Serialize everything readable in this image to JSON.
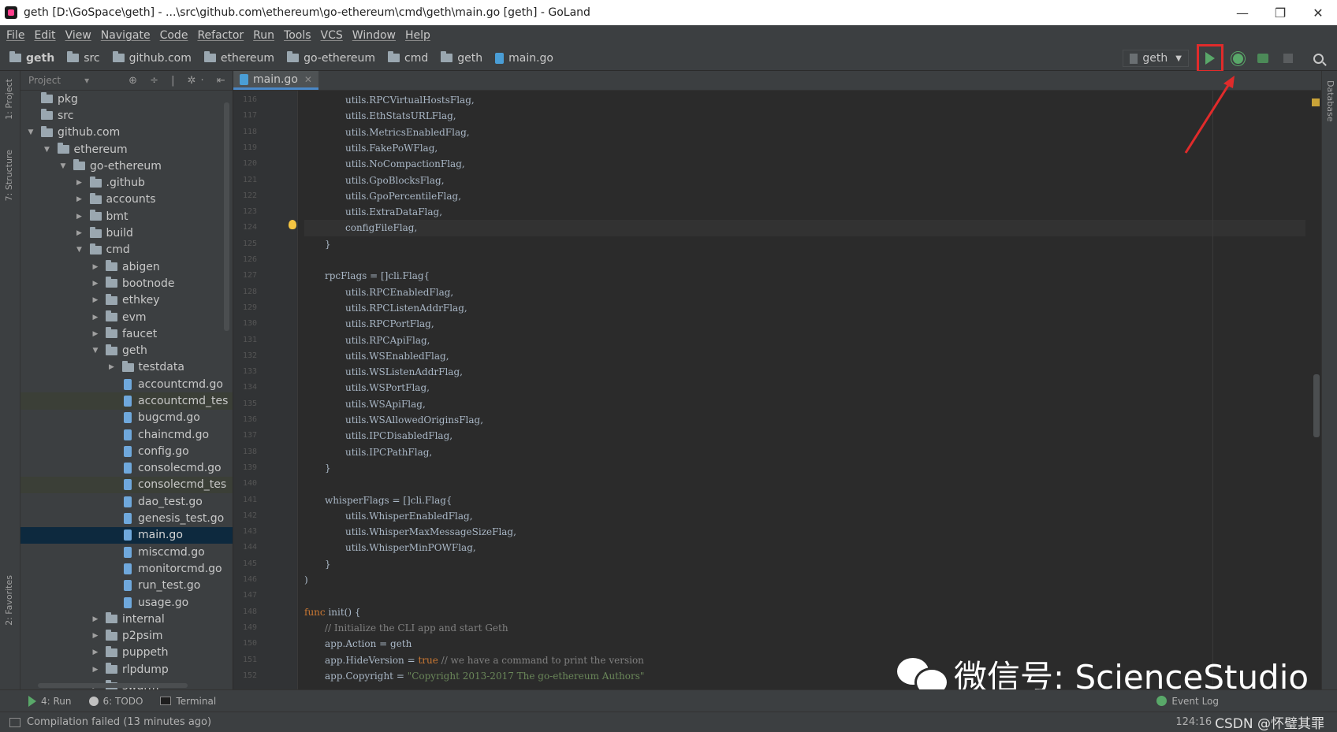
{
  "window": {
    "title": "geth [D:\\GoSpace\\geth] - ...\\src\\github.com\\ethereum\\go-ethereum\\cmd\\geth\\main.go [geth] - GoLand",
    "minimize": "—",
    "restore": "❐",
    "close": "✕"
  },
  "menu": [
    "File",
    "Edit",
    "View",
    "Navigate",
    "Code",
    "Refactor",
    "Run",
    "Tools",
    "VCS",
    "Window",
    "Help"
  ],
  "breadcrumbs": [
    "geth",
    "src",
    "github.com",
    "ethereum",
    "go-ethereum",
    "cmd",
    "geth",
    "main.go"
  ],
  "run_config": {
    "name": "geth",
    "dropdown": "▼"
  },
  "project_panel": {
    "title": "Project",
    "dropdown": "▾",
    "tools": "⊕ ÷ | ✲· ⇤"
  },
  "tree": [
    {
      "label": "pkg",
      "depth": 0,
      "type": "folder",
      "arrow": ""
    },
    {
      "label": "src",
      "depth": 0,
      "type": "folder",
      "arrow": ""
    },
    {
      "label": "github.com",
      "depth": 0,
      "type": "folder",
      "arrow": "▼"
    },
    {
      "label": "ethereum",
      "depth": 1,
      "type": "folder",
      "arrow": "▼"
    },
    {
      "label": "go-ethereum",
      "depth": 2,
      "type": "folder",
      "arrow": "▼"
    },
    {
      "label": ".github",
      "depth": 3,
      "type": "folder",
      "arrow": "▶"
    },
    {
      "label": "accounts",
      "depth": 3,
      "type": "folder",
      "arrow": "▶"
    },
    {
      "label": "bmt",
      "depth": 3,
      "type": "folder",
      "arrow": "▶"
    },
    {
      "label": "build",
      "depth": 3,
      "type": "folder",
      "arrow": "▶"
    },
    {
      "label": "cmd",
      "depth": 3,
      "type": "folder",
      "arrow": "▼"
    },
    {
      "label": "abigen",
      "depth": 4,
      "type": "folder",
      "arrow": "▶"
    },
    {
      "label": "bootnode",
      "depth": 4,
      "type": "folder",
      "arrow": "▶"
    },
    {
      "label": "ethkey",
      "depth": 4,
      "type": "folder",
      "arrow": "▶"
    },
    {
      "label": "evm",
      "depth": 4,
      "type": "folder",
      "arrow": "▶"
    },
    {
      "label": "faucet",
      "depth": 4,
      "type": "folder",
      "arrow": "▶"
    },
    {
      "label": "geth",
      "depth": 4,
      "type": "folder",
      "arrow": "▼"
    },
    {
      "label": "testdata",
      "depth": 5,
      "type": "folder",
      "arrow": "▶"
    },
    {
      "label": "accountcmd.go",
      "depth": 6,
      "type": "file",
      "arrow": ""
    },
    {
      "label": "accountcmd_tes",
      "depth": 6,
      "type": "file",
      "arrow": "",
      "warn": true
    },
    {
      "label": "bugcmd.go",
      "depth": 6,
      "type": "file",
      "arrow": ""
    },
    {
      "label": "chaincmd.go",
      "depth": 6,
      "type": "file",
      "arrow": ""
    },
    {
      "label": "config.go",
      "depth": 6,
      "type": "file",
      "arrow": ""
    },
    {
      "label": "consolecmd.go",
      "depth": 6,
      "type": "file",
      "arrow": ""
    },
    {
      "label": "consolecmd_tes",
      "depth": 6,
      "type": "file",
      "arrow": "",
      "warn": true
    },
    {
      "label": "dao_test.go",
      "depth": 6,
      "type": "file",
      "arrow": ""
    },
    {
      "label": "genesis_test.go",
      "depth": 6,
      "type": "file",
      "arrow": ""
    },
    {
      "label": "main.go",
      "depth": 6,
      "type": "file",
      "arrow": "",
      "selected": true
    },
    {
      "label": "misccmd.go",
      "depth": 6,
      "type": "file",
      "arrow": ""
    },
    {
      "label": "monitorcmd.go",
      "depth": 6,
      "type": "file",
      "arrow": ""
    },
    {
      "label": "run_test.go",
      "depth": 6,
      "type": "file",
      "arrow": ""
    },
    {
      "label": "usage.go",
      "depth": 6,
      "type": "file",
      "arrow": ""
    },
    {
      "label": "internal",
      "depth": 4,
      "type": "folder",
      "arrow": "▶"
    },
    {
      "label": "p2psim",
      "depth": 4,
      "type": "folder",
      "arrow": "▶"
    },
    {
      "label": "puppeth",
      "depth": 4,
      "type": "folder",
      "arrow": "▶"
    },
    {
      "label": "rlpdump",
      "depth": 4,
      "type": "folder",
      "arrow": "▶"
    },
    {
      "label": "swarm",
      "depth": 4,
      "type": "folder",
      "arrow": "▶"
    }
  ],
  "left_tabs": [
    "1: Project",
    "7: Structure",
    "2: Favorites"
  ],
  "right_tabs": [
    "Database"
  ],
  "editor": {
    "tab": "main.go",
    "tab_close": "✕",
    "line_numbers": [
      "116",
      "117",
      "118",
      "119",
      "120",
      "121",
      "122",
      "123",
      "124",
      "125",
      "126",
      "127",
      "128",
      "129",
      "130",
      "131",
      "132",
      "133",
      "134",
      "135",
      "136",
      "137",
      "138",
      "139",
      "140",
      "141",
      "142",
      "143",
      "144",
      "145",
      "146",
      "147",
      "148",
      "149",
      "150",
      "151",
      "152"
    ],
    "code": [
      {
        "indent": 2,
        "parts": [
          {
            "t": "utils.RPCVirtualHostsFlag,",
            "c": ""
          }
        ]
      },
      {
        "indent": 2,
        "parts": [
          {
            "t": "utils.EthStatsURLFlag,",
            "c": ""
          }
        ]
      },
      {
        "indent": 2,
        "parts": [
          {
            "t": "utils.MetricsEnabledFlag,",
            "c": ""
          }
        ]
      },
      {
        "indent": 2,
        "parts": [
          {
            "t": "utils.FakePoWFlag,",
            "c": ""
          }
        ]
      },
      {
        "indent": 2,
        "parts": [
          {
            "t": "utils.NoCompactionFlag,",
            "c": ""
          }
        ]
      },
      {
        "indent": 2,
        "parts": [
          {
            "t": "utils.GpoBlocksFlag,",
            "c": ""
          }
        ]
      },
      {
        "indent": 2,
        "parts": [
          {
            "t": "utils.GpoPercentileFlag,",
            "c": ""
          }
        ]
      },
      {
        "indent": 2,
        "parts": [
          {
            "t": "utils.ExtraDataFlag,",
            "c": ""
          }
        ]
      },
      {
        "indent": 2,
        "parts": [
          {
            "t": "configFileFlag,",
            "c": ""
          }
        ],
        "hl": true
      },
      {
        "indent": 1,
        "parts": [
          {
            "t": "}",
            "c": ""
          }
        ]
      },
      {
        "indent": 0,
        "parts": [
          {
            "t": "",
            "c": ""
          }
        ]
      },
      {
        "indent": 1,
        "parts": [
          {
            "t": "rpcFlags = []cli.Flag{",
            "c": ""
          }
        ]
      },
      {
        "indent": 2,
        "parts": [
          {
            "t": "utils.RPCEnabledFlag,",
            "c": ""
          }
        ]
      },
      {
        "indent": 2,
        "parts": [
          {
            "t": "utils.RPCListenAddrFlag,",
            "c": ""
          }
        ]
      },
      {
        "indent": 2,
        "parts": [
          {
            "t": "utils.RPCPortFlag,",
            "c": ""
          }
        ]
      },
      {
        "indent": 2,
        "parts": [
          {
            "t": "utils.RPCApiFlag,",
            "c": ""
          }
        ]
      },
      {
        "indent": 2,
        "parts": [
          {
            "t": "utils.WSEnabledFlag,",
            "c": ""
          }
        ]
      },
      {
        "indent": 2,
        "parts": [
          {
            "t": "utils.WSListenAddrFlag,",
            "c": ""
          }
        ]
      },
      {
        "indent": 2,
        "parts": [
          {
            "t": "utils.WSPortFlag,",
            "c": ""
          }
        ]
      },
      {
        "indent": 2,
        "parts": [
          {
            "t": "utils.WSApiFlag,",
            "c": ""
          }
        ]
      },
      {
        "indent": 2,
        "parts": [
          {
            "t": "utils.WSAllowedOriginsFlag,",
            "c": ""
          }
        ]
      },
      {
        "indent": 2,
        "parts": [
          {
            "t": "utils.IPCDisabledFlag,",
            "c": ""
          }
        ]
      },
      {
        "indent": 2,
        "parts": [
          {
            "t": "utils.IPCPathFlag,",
            "c": ""
          }
        ]
      },
      {
        "indent": 1,
        "parts": [
          {
            "t": "}",
            "c": ""
          }
        ]
      },
      {
        "indent": 0,
        "parts": [
          {
            "t": "",
            "c": ""
          }
        ]
      },
      {
        "indent": 1,
        "parts": [
          {
            "t": "whisperFlags = []cli.Flag{",
            "c": ""
          }
        ]
      },
      {
        "indent": 2,
        "parts": [
          {
            "t": "utils.WhisperEnabledFlag,",
            "c": ""
          }
        ]
      },
      {
        "indent": 2,
        "parts": [
          {
            "t": "utils.WhisperMaxMessageSizeFlag,",
            "c": ""
          }
        ]
      },
      {
        "indent": 2,
        "parts": [
          {
            "t": "utils.WhisperMinPOWFlag,",
            "c": ""
          }
        ]
      },
      {
        "indent": 1,
        "parts": [
          {
            "t": "}",
            "c": ""
          }
        ]
      },
      {
        "indent": 0,
        "parts": [
          {
            "t": ")",
            "c": ""
          }
        ]
      },
      {
        "indent": 0,
        "parts": [
          {
            "t": "",
            "c": ""
          }
        ]
      },
      {
        "indent": 0,
        "parts": [
          {
            "t": "func",
            "c": "kw"
          },
          {
            "t": " init() {",
            "c": ""
          }
        ]
      },
      {
        "indent": 1,
        "parts": [
          {
            "t": "// Initialize the CLI app and start Geth",
            "c": "cm"
          }
        ]
      },
      {
        "indent": 1,
        "parts": [
          {
            "t": "app.Action = geth",
            "c": ""
          }
        ]
      },
      {
        "indent": 1,
        "parts": [
          {
            "t": "app.HideVersion = ",
            "c": ""
          },
          {
            "t": "true",
            "c": "kw"
          },
          {
            "t": " // we have a command to print the version",
            "c": "cm"
          }
        ]
      },
      {
        "indent": 1,
        "parts": [
          {
            "t": "app.Copyright = ",
            "c": ""
          },
          {
            "t": "\"Copyright 2013-2017 The go-ethereum Authors\"",
            "c": "st"
          }
        ]
      }
    ]
  },
  "bottom_tools": [
    {
      "label": "4: Run",
      "icon": "run-icon"
    },
    {
      "label": "6: TODO",
      "icon": "todo-icon"
    },
    {
      "label": "Terminal",
      "icon": "terminal-icon"
    }
  ],
  "event_log": "Event Log",
  "status": {
    "message": "Compilation failed (13 minutes ago)",
    "position": "124:16",
    "csdn": "CSDN @怀璧其罪"
  },
  "watermark": "微信号: ScienceStudio"
}
